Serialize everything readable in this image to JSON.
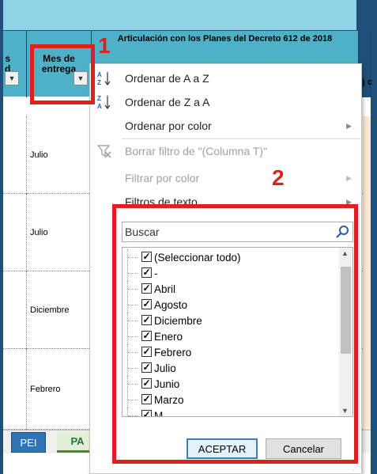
{
  "header": {
    "col_s_label": "s\nd",
    "col_mes_label": "Mes de entrega",
    "col_art_label": "Articulación con los Planes del Decreto 612 de 2018",
    "right_fragment": ") c"
  },
  "rows": [
    {
      "mes": "Julio"
    },
    {
      "mes": "Julio"
    },
    {
      "mes": "Diciembre"
    },
    {
      "mes": "Febrero"
    }
  ],
  "sheet_tabs": [
    "PEI",
    "PA"
  ],
  "menu": {
    "items": [
      {
        "icon": "sort-ascending-icon",
        "label": "Ordenar de A a Z",
        "enabled": true,
        "submenu": false
      },
      {
        "icon": "sort-descending-icon",
        "label": "Ordenar de Z a A",
        "enabled": true,
        "submenu": false
      },
      {
        "icon": "",
        "label": "Ordenar por color",
        "enabled": true,
        "submenu": true
      },
      {
        "icon": "clear-filter-icon",
        "label": "Borrar filtro de \"(Columna T)\"",
        "enabled": false,
        "submenu": false
      },
      {
        "icon": "",
        "label": "Filtrar por color",
        "enabled": false,
        "submenu": true
      },
      {
        "icon": "",
        "label": "Filtros de texto",
        "enabled": true,
        "submenu": true
      }
    ],
    "search_placeholder": "Buscar",
    "list": [
      {
        "label": "(Seleccionar todo)",
        "checked": true
      },
      {
        "label": "-",
        "checked": true
      },
      {
        "label": "Abril",
        "checked": true
      },
      {
        "label": "Agosto",
        "checked": true
      },
      {
        "label": "Diciembre",
        "checked": true
      },
      {
        "label": "Enero",
        "checked": true
      },
      {
        "label": "Febrero",
        "checked": true
      },
      {
        "label": "Julio",
        "checked": true
      },
      {
        "label": "Junio",
        "checked": true
      },
      {
        "label": "Marzo",
        "checked": true
      },
      {
        "label": "M",
        "checked": true
      }
    ],
    "ok_label": "ACEPTAR",
    "cancel_label": "Cancelar"
  },
  "annotations": {
    "step1": "1",
    "step2": "2",
    "color": "#e02020"
  },
  "colors": {
    "header_teal": "#4fb1c7",
    "frame_blue": "#1f4e79",
    "tab_blue": "#2e75b6",
    "tab_green_text": "#1e7b34"
  }
}
